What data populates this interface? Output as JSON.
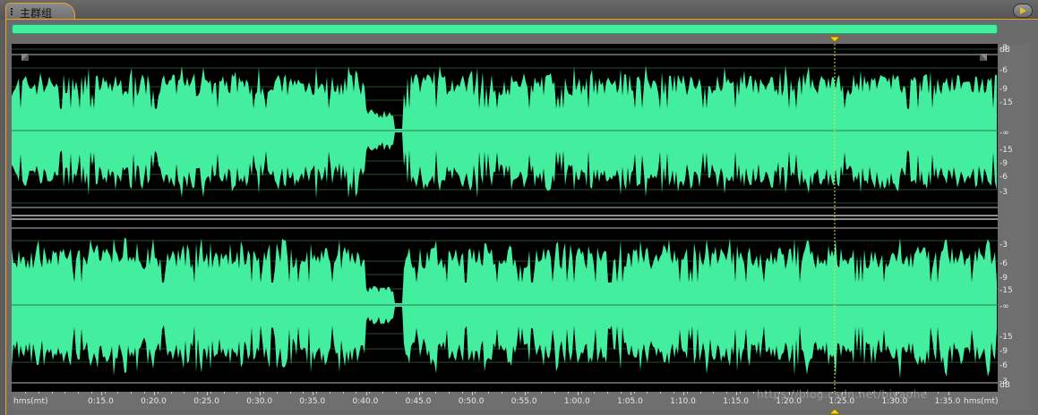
{
  "tab": {
    "label": "主群组"
  },
  "db_scale": {
    "unit": "dB",
    "channel1": [
      "dB",
      "-3",
      "-6",
      "-9",
      "-15",
      "-∞",
      "-15",
      "-9",
      "-6",
      "-3"
    ],
    "channel2": [
      "-3",
      "-6",
      "-9",
      "-15",
      "-∞",
      "-15",
      "-9",
      "-6",
      "-3",
      "dB"
    ]
  },
  "timeline": {
    "format": "hms(mt)",
    "ticks": [
      "0:15.0",
      "0:20.0",
      "0:25.0",
      "0:30.0",
      "0:35.0",
      "0:40.0",
      "0:45.0",
      "0:50.0",
      "0:55.0",
      "1:00.0",
      "1:05.0",
      "1:10.0",
      "1:15.0",
      "1:20.0",
      "1:25.0",
      "1:30.0",
      "1:35.0"
    ],
    "end_label": "hms(mt)"
  },
  "watermark": "https://blog.csdn.net/biyaohe",
  "colors": {
    "waveform": "#44ee9f",
    "accent": "#f0a020",
    "background": "#000000"
  }
}
